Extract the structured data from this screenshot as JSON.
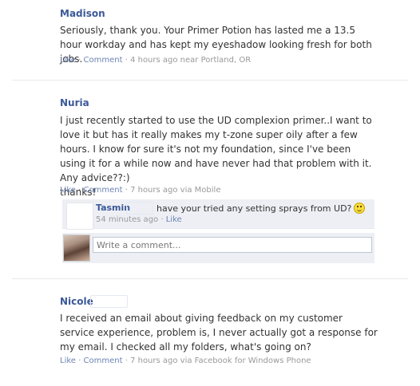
{
  "posts": [
    {
      "name": "Madison",
      "message": "Seriously, thank you. Your Primer Potion has lasted me a 13.5 hour workday and has kept my eyeshadow looking fresh for both jobs.",
      "like": "Like",
      "comment": "Comment",
      "time": "4 hours ago near Portland, OR"
    },
    {
      "name": "Nuria",
      "message": "I just recently started to use the UD complexion primer..I want to love it but has it really makes my t-zone super oily after a few hours. I know for sure it's not my foundation, since I've been using it for a while now and have never had that problem with it. Any advice??:)\nthanks!",
      "like": "Like",
      "comment": "Comment",
      "time": "7 hours ago via Mobile"
    },
    {
      "name": "Nicole",
      "message": "I received an email about giving feedback on my customer service experience, problem is, I never actually got a response for my email. I checked all my folders, what's going on?",
      "like": "Like",
      "comment": "Comment",
      "time": "7 hours ago via Facebook for Windows Phone"
    }
  ],
  "reply": {
    "name": "Tasmin",
    "text": "have your tried any setting sprays from UD?",
    "time": "54 minutes ago",
    "like": "Like"
  },
  "write_comment": {
    "placeholder": "Write a comment..."
  },
  "separator": "·",
  "colors": {
    "name": "#3b5998",
    "link": "#6d84b4",
    "meta": "#999999",
    "reply_bg": "#edeff4"
  },
  "icons": [
    "smiley-icon",
    "avatar-photo"
  ]
}
